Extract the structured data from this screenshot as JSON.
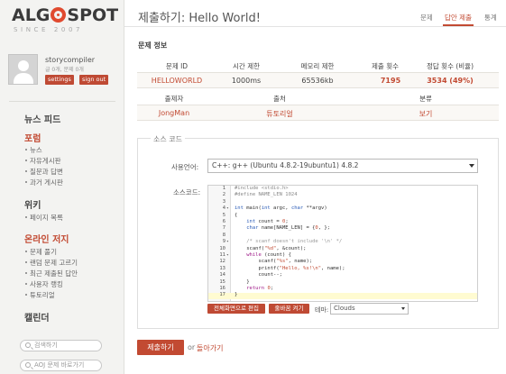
{
  "brand": {
    "logo_left": "ALG",
    "logo_right": "SPOT",
    "since": "SINCE 2007"
  },
  "user": {
    "name": "storycompiler",
    "stats": "글 0개, 문제 0개",
    "settings_label": "settings",
    "signout_label": "sign out"
  },
  "sidebar": {
    "news_feed": "뉴스 피드",
    "forum": {
      "title": "포럼",
      "items": [
        "뉴스",
        "자유게시판",
        "질문과 답변",
        "과거 게시판"
      ]
    },
    "wiki": {
      "title": "위키",
      "items": [
        "페이지 목록"
      ]
    },
    "judge": {
      "title": "온라인 저지",
      "items": [
        "문제 풀기",
        "랜덤 문제 고르기",
        "최근 제출된 답안",
        "사용자 랭킹",
        "튜토리얼"
      ]
    },
    "calendar": "캘린더",
    "search_placeholder": "검색하기",
    "problem_goto_placeholder": "AOJ 문제 바로가기"
  },
  "page": {
    "title": "제출하기: Hello World!",
    "tabs": [
      {
        "label": "문제",
        "active": false
      },
      {
        "label": "답안 제출",
        "active": true
      },
      {
        "label": "통계",
        "active": false
      }
    ]
  },
  "problem_info": {
    "heading": "문제 정보",
    "headers1": [
      "문제 ID",
      "시간 제한",
      "메모리 제한",
      "제출 횟수",
      "정답 횟수 (비율)"
    ],
    "values1": [
      "HELLOWORLD",
      "1000ms",
      "65536kb",
      "7195",
      "3534 (49%)"
    ],
    "headers2": [
      "출제자",
      "출처",
      "분류"
    ],
    "values2": [
      "JongMan",
      "튜토리얼",
      "보기"
    ]
  },
  "source": {
    "legend": "소스 코드",
    "language_label": "사용언어:",
    "language_value": "C++: g++ (Ubuntu 4.8.2-19ubuntu1) 4.8.2",
    "code_label": "소스코드:",
    "line_numbers": [
      "1",
      "2",
      "3",
      "4",
      "5",
      "6",
      "7",
      "8",
      "9",
      "10",
      "11",
      "12",
      "13",
      "14",
      "15",
      "16",
      "17"
    ],
    "fullscreen_label": "전체화면으로 편집",
    "linenumber_label": "줄바꿈 켜기",
    "theme_label": "테마:",
    "theme_value": "Clouds"
  },
  "actions": {
    "submit_label": "제출하기",
    "or_text": "or",
    "back_label": "돌아가기"
  },
  "colors": {
    "accent": "#c24a32",
    "sidebar_bg": "#f3f3f1",
    "active_line": "#fffbd1"
  }
}
